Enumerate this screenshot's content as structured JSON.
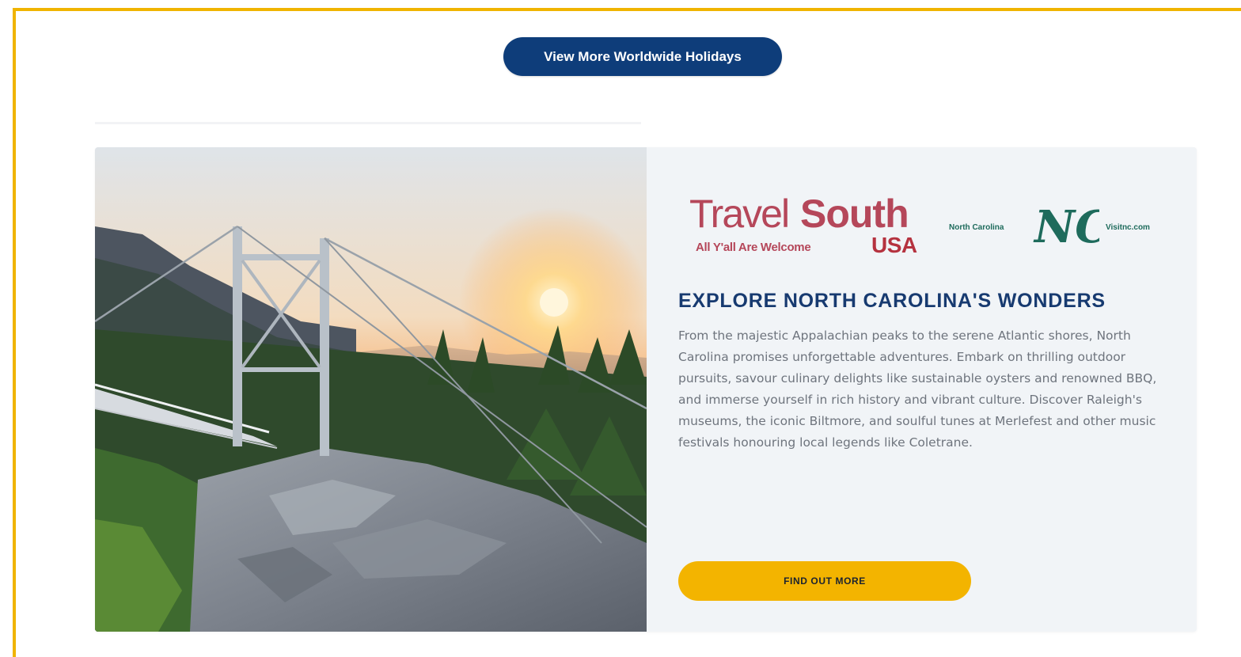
{
  "top_button": {
    "label": "View More Worldwide Holidays"
  },
  "promo": {
    "image": "mile-high-swinging-bridge-sunrise-photo",
    "partner_logo": {
      "travel": "Travel",
      "south": "South",
      "tagline": "All Y'all Are Welcome",
      "usa": "USA"
    },
    "nc_logo": {
      "left_text": "North Carolina",
      "mark": "NC",
      "right_text": "Visitnc.com"
    },
    "headline": "EXPLORE NORTH CAROLINA'S WONDERS",
    "body": "From the majestic Appalachian peaks to the serene Atlantic shores, North Carolina promises unforgettable adventures. Embark on thrilling outdoor pursuits, savour culinary delights like sustainable oysters and renowned BBQ, and immerse yourself in rich history and vibrant culture. Discover Raleigh's museums, the iconic Biltmore, and soulful tunes at Merlefest and other music festivals honouring local legends like Coletrane.",
    "cta_label": "FIND OUT MORE"
  },
  "colors": {
    "frame_border": "#f0b400",
    "primary_button": "#0e3d7a",
    "cta_button": "#f3b400",
    "headline": "#173a70",
    "travelsouth_brand": "#b5475a",
    "nc_brand": "#1e6b5c",
    "card_background": "#f1f4f7"
  }
}
